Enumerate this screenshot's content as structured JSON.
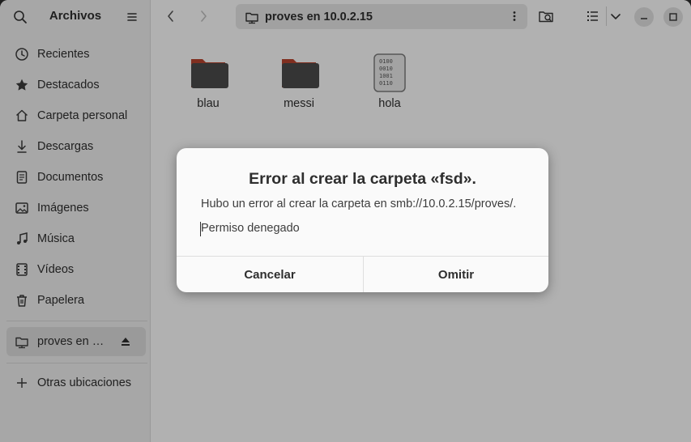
{
  "sidebar": {
    "title": "Archivos",
    "items": [
      {
        "label": "Recientes",
        "icon": "clock-icon"
      },
      {
        "label": "Destacados",
        "icon": "star-icon"
      },
      {
        "label": "Carpeta personal",
        "icon": "home-icon"
      },
      {
        "label": "Descargas",
        "icon": "download-icon"
      },
      {
        "label": "Documentos",
        "icon": "document-icon"
      },
      {
        "label": "Imágenes",
        "icon": "image-icon"
      },
      {
        "label": "Música",
        "icon": "music-icon"
      },
      {
        "label": "Vídeos",
        "icon": "video-icon"
      },
      {
        "label": "Papelera",
        "icon": "trash-icon"
      }
    ],
    "mount": {
      "label": "proves en …",
      "icon": "folder-network-icon"
    },
    "other_locations": {
      "label": "Otras ubicaciones",
      "icon": "plus-icon"
    }
  },
  "header": {
    "path": "proves en 10.0.2.15"
  },
  "files": [
    {
      "name": "blau",
      "type": "folder"
    },
    {
      "name": "messi",
      "type": "folder"
    },
    {
      "name": "hola",
      "type": "binary-file"
    }
  ],
  "dialog": {
    "title": "Error al crear la carpeta «fsd».",
    "message": "Hubo un error al crear la carpeta en smb://10.0.2.15/proves/.",
    "detail": "Permiso denegado",
    "cancel_label": "Cancelar",
    "skip_label": "Omitir"
  },
  "colors": {
    "folder_body": "#4a4a4a",
    "folder_tab": "#b5432e",
    "sidebar_bg": "#ebebeb",
    "dim_overlay": "rgba(0,0,0,0.29)"
  }
}
